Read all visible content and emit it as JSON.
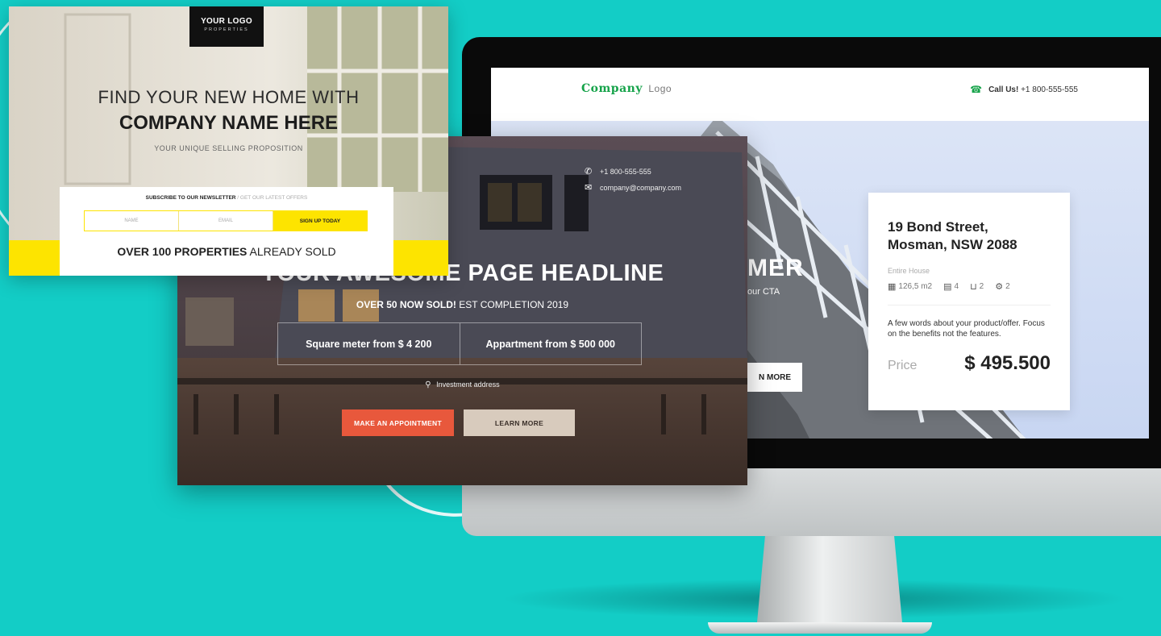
{
  "colors": {
    "background": "#13cdc6",
    "brand_green": "#16a34a",
    "cta_orange": "#e8583c",
    "cta_beige": "#d8cbbd",
    "accent_yellow": "#fde400"
  },
  "top_left_page": {
    "logo_main": "YOUR LOGO",
    "logo_sub": "PROPERTIES",
    "headline_line1": "FIND YOUR NEW HOME WITH",
    "headline_line2": "COMPANY NAME HERE",
    "usp": "YOUR UNIQUE SELLING PROPOSITION",
    "newsletter_title_bold": "SUBSCRIBE TO OUR NEWSLETTER",
    "newsletter_title_rest": "/ GET OUR LATEST OFFERS",
    "name_placeholder": "NAME",
    "email_placeholder": "EMAIL",
    "signup_label": "SIGN UP TODAY",
    "sold_bold": "OVER 100 PROPERTIES",
    "sold_rest": "ALREADY SOLD"
  },
  "middle_page": {
    "phone": "+1 800-555-555",
    "email": "company@company.com",
    "phone_icon": "phone-icon",
    "email_icon": "mail-icon",
    "headline": "YOUR AWESOME PAGE HEADLINE",
    "sub_bold": "OVER 50 NOW SOLD!",
    "sub_rest": "EST COMPLETION 2019",
    "stat_square_meter": "Square meter from $ 4 200",
    "stat_appartment": "Appartment from $ 500 000",
    "address_icon": "map-pin-icon",
    "address": "Investment address",
    "appointment_button": "MAKE AN APPOINTMENT",
    "learn_more_button": "LEARN MORE"
  },
  "monitor_page": {
    "brand": "Company",
    "brand_sub": "Logo",
    "call_label": "Call Us!",
    "call_number": "+1 800-555-555",
    "hero_fragment": "MER",
    "hero_cta_fragment": "our CTA",
    "learn_more_fragment": "N MORE",
    "listing": {
      "address": "19 Bond Street, Mosman, NSW 2088",
      "type": "Entire House",
      "area": "126,5 m2",
      "bedrooms": "4",
      "bathrooms": "2",
      "garages": "2",
      "description": "A few words about your product/offer. Focus on the benefits not the features.",
      "price_label": "Price",
      "price_value": "$ 495.500"
    }
  }
}
